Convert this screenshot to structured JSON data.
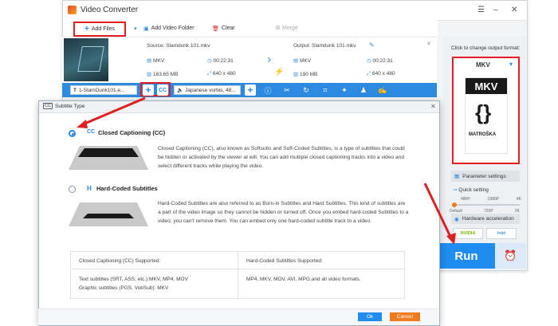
{
  "app": {
    "title": "Video Converter"
  },
  "toolbar": {
    "add_files": "Add Files",
    "add_video_folder": "Add Video Folder",
    "clear": "Clear",
    "merge": "Merge"
  },
  "source": {
    "label": "Source: Slamdunk 101.mkv",
    "format": "MKV",
    "duration": "00:22:31",
    "size": "183.65 MB",
    "resolution": "640 x 480"
  },
  "output": {
    "label": "Output: Slamdunk 101.mkv",
    "format": "MKV",
    "duration": "00:22:31",
    "size": "190 MB",
    "resolution": "640 x 480"
  },
  "tracks": {
    "subtitle": "1-SlamDunk101.e...",
    "audio": "Japanese vorbis, 48..."
  },
  "right_panel": {
    "change_format": "Click to change output format:",
    "format": "MKV",
    "logo_top": "MKV",
    "logo_bottom": "MATROŠKA",
    "param_settings": "Parameter settings",
    "quick_setting": "Quick setting",
    "quality_top": [
      "480P",
      "1080P",
      "4K"
    ],
    "quality_bottom": [
      "Default",
      "720P",
      "2K"
    ],
    "hw_accel": "Hardware acceleration",
    "nvidia": "NVIDIA",
    "intel": "Intel"
  },
  "run": {
    "label": "Run"
  },
  "dialog": {
    "title": "Subtitle Type",
    "cc_title": "Closed Captioning (CC)",
    "cc_desc": "Closed Captioning (CC), also known as Softsubs and Soft-Coded Subtitles, is a type of subtitles that could be hidden or activated by the viewer at will. You can add multiple closed captioning tracks into a video and select different tracks while playing the video.",
    "hc_title": "Hard-Coded Subtitles",
    "hc_desc": "Hard-Coded Subtitles are also referred to as Burn-in Subtitles and Hard Subtitles. This kind of subtitles are a part of the video image so they cannot be hidden or turned off. Once you embed hard-coded Subtitles to a video, you can't remove them. You can embed only one hard-coded subtitle track to a video.",
    "table_head_cc": "Closed Captioning (CC) Supported:",
    "table_head_hc": "Hard-Coded Subtitles Supported:",
    "table_cc_line1": "Text subtitles (SRT, ASS, etc.):MKV, MP4, MOV",
    "table_cc_line2": "Graphic subtitles (PGS, VobSub): MKV",
    "table_hc": "MP4, MKV, MOV, AVI, MPG,and all video formats.",
    "ok": "Ok",
    "cancel": "Cancel"
  },
  "colors": {
    "accent": "#1e8cf0",
    "highlight": "#e02020",
    "cancel": "#f07c1e"
  }
}
